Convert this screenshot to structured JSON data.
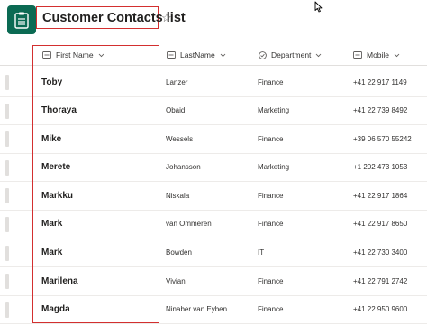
{
  "header": {
    "title": "Customer Contacts list"
  },
  "columns": {
    "first_name": "First Name",
    "last_name": "LastName",
    "department": "Department",
    "mobile": "Mobile"
  },
  "rows": [
    {
      "first": "Toby",
      "last": "Lanzer",
      "dept": "Finance",
      "mobile": "+41 22 917 1149"
    },
    {
      "first": "Thoraya",
      "last": "Obaid",
      "dept": "Marketing",
      "mobile": "+41 22 739 8492"
    },
    {
      "first": "Mike",
      "last": "Wessels",
      "dept": "Finance",
      "mobile": "+39 06 570 55242"
    },
    {
      "first": "Merete",
      "last": "Johansson",
      "dept": "Marketing",
      "mobile": "+1 202 473 1053"
    },
    {
      "first": "Markku",
      "last": "Niskala",
      "dept": "Finance",
      "mobile": "+41 22 917 1864"
    },
    {
      "first": "Mark",
      "last": "van Ommeren",
      "dept": "Finance",
      "mobile": "+41 22 917 8650"
    },
    {
      "first": "Mark",
      "last": "Bowden",
      "dept": "IT",
      "mobile": "+41 22 730 3400"
    },
    {
      "first": "Marilena",
      "last": "Viviani",
      "dept": "Finance",
      "mobile": "+41 22 791 2742"
    },
    {
      "first": "Magda",
      "last": "Ninaber van Eyben",
      "dept": "Finance",
      "mobile": "+41 22 950 9600"
    }
  ],
  "icons": {
    "app": "list-app-icon",
    "favorite": "star-outline-icon",
    "cursor": "mouse-pointer-icon",
    "text_column": "text-field-icon",
    "choice_column": "choice-field-icon",
    "sort": "chevron-down-icon"
  },
  "colors": {
    "app_icon": "#0b6a53",
    "highlight": "#d32f2f"
  }
}
